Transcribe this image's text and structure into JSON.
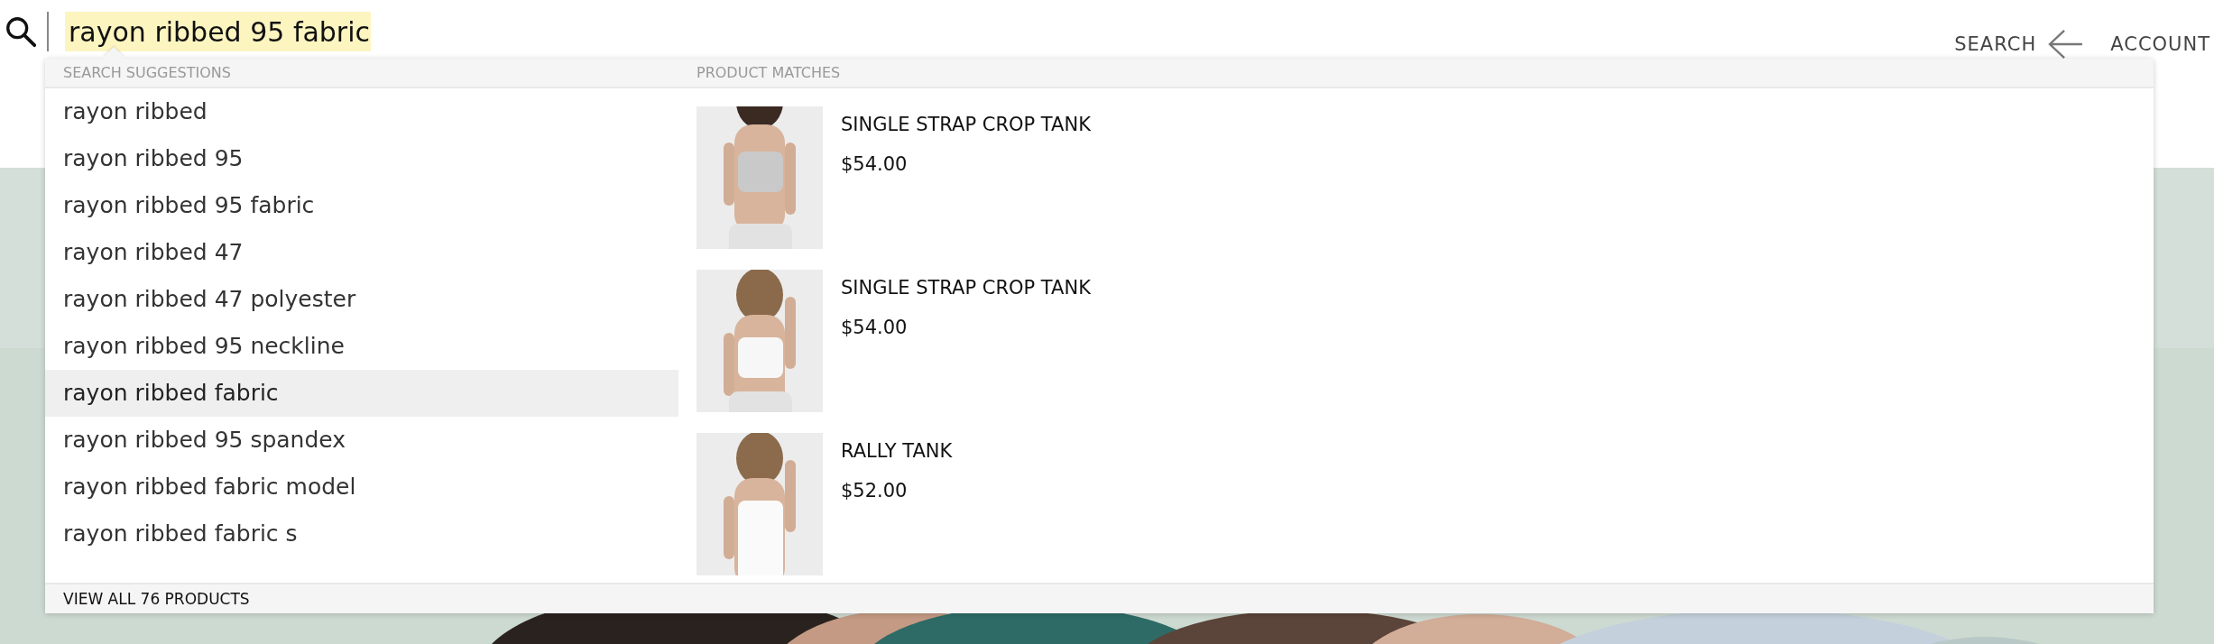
{
  "search": {
    "value": "rayon ribbed 95 fabric"
  },
  "nav": {
    "search_label": "SEARCH",
    "account_label": "ACCOUNT"
  },
  "dropdown": {
    "suggestions_heading": "SEARCH SUGGESTIONS",
    "products_heading": "PRODUCT MATCHES",
    "suggestions": [
      {
        "text": "rayon ribbed",
        "selected": false
      },
      {
        "text": "rayon ribbed 95",
        "selected": false
      },
      {
        "text": "rayon ribbed 95 fabric",
        "selected": false
      },
      {
        "text": "rayon ribbed 47",
        "selected": false
      },
      {
        "text": "rayon ribbed 47 polyester",
        "selected": false
      },
      {
        "text": "rayon ribbed 95 neckline",
        "selected": false
      },
      {
        "text": "rayon ribbed fabric",
        "selected": true
      },
      {
        "text": "rayon ribbed 95 spandex",
        "selected": false
      },
      {
        "text": "rayon ribbed fabric model",
        "selected": false
      },
      {
        "text": "rayon ribbed fabric s",
        "selected": false
      }
    ],
    "products": [
      {
        "name": "SINGLE STRAP CROP TANK",
        "price": "$54.00"
      },
      {
        "name": "SINGLE STRAP CROP TANK",
        "price": "$54.00"
      },
      {
        "name": "RALLY TANK",
        "price": "$52.00"
      }
    ],
    "footer": "VIEW ALL 76 PRODUCTS"
  }
}
